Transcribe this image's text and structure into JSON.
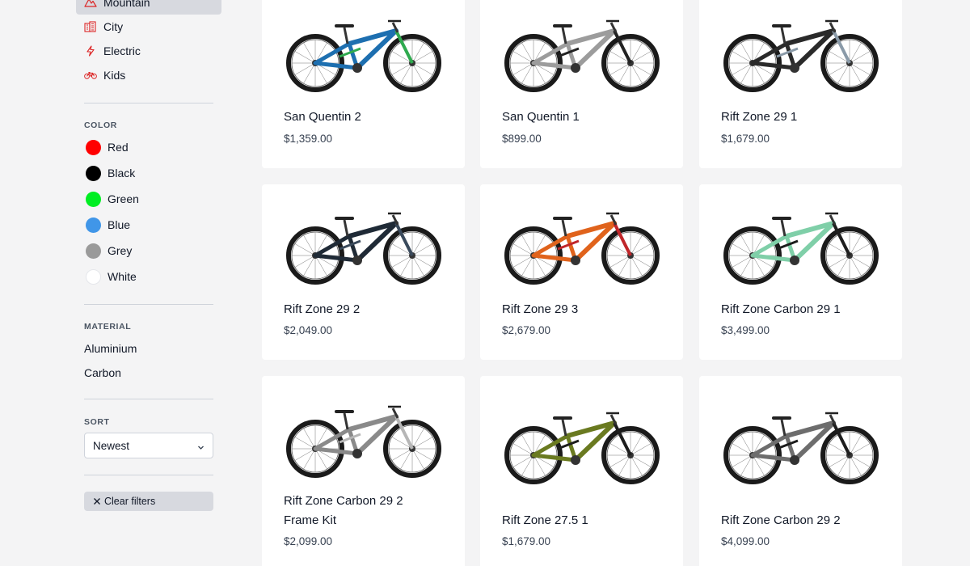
{
  "categories": [
    {
      "label": "Mountain",
      "icon": "mountain-icon",
      "active": true
    },
    {
      "label": "City",
      "icon": "city-icon",
      "active": false
    },
    {
      "label": "Electric",
      "icon": "lightning-icon",
      "active": false
    },
    {
      "label": "Kids",
      "icon": "bicycle-icon",
      "active": false
    }
  ],
  "accent_color": "#dc2626",
  "color_filter": {
    "title": "COLOR",
    "options": [
      {
        "label": "Red",
        "hex": "#ff0000"
      },
      {
        "label": "Black",
        "hex": "#000000"
      },
      {
        "label": "Green",
        "hex": "#00ee22"
      },
      {
        "label": "Blue",
        "hex": "#4096e8"
      },
      {
        "label": "Grey",
        "hex": "#9a9a9a"
      },
      {
        "label": "White",
        "hex": "#ffffff"
      }
    ]
  },
  "material_filter": {
    "title": "MATERIAL",
    "options": [
      "Aluminium",
      "Carbon"
    ]
  },
  "sort": {
    "title": "SORT",
    "selected": "Newest"
  },
  "clear_filters_label": "Clear filters",
  "products": [
    {
      "name": "San Quentin 2",
      "price": "$1,359.00",
      "frame_color": "#1d6fb0",
      "accent": "#2faa4f"
    },
    {
      "name": "San Quentin 1",
      "price": "$899.00",
      "frame_color": "#9c9c9c",
      "accent": "#222222"
    },
    {
      "name": "Rift Zone 29 1",
      "price": "$1,679.00",
      "frame_color": "#2a2a2a",
      "accent": "#8a9aa8"
    },
    {
      "name": "Rift Zone 29 2",
      "price": "$2,049.00",
      "frame_color": "#1f2a36",
      "accent": "#3a4a5c"
    },
    {
      "name": "Rift Zone 29 3",
      "price": "$2,679.00",
      "frame_color": "#e0631c",
      "accent": "#c0262a"
    },
    {
      "name": "Rift Zone Carbon 29 1",
      "price": "$3,499.00",
      "frame_color": "#7fcfa8",
      "accent": "#1d1d1d"
    },
    {
      "name": "Rift Zone Carbon 29 2",
      "name2": "Frame Kit",
      "price": "$2,099.00",
      "frame_color": "#8a8a8a",
      "accent": "#b6b6b6"
    },
    {
      "name": "Rift Zone 27.5 1",
      "price": "$1,679.00",
      "frame_color": "#6a7a20",
      "accent": "#1d1d1d"
    },
    {
      "name": "Rift Zone Carbon 29 2",
      "price": "$4,099.00",
      "frame_color": "#6d6d6d",
      "accent": "#1d1d1d"
    }
  ]
}
